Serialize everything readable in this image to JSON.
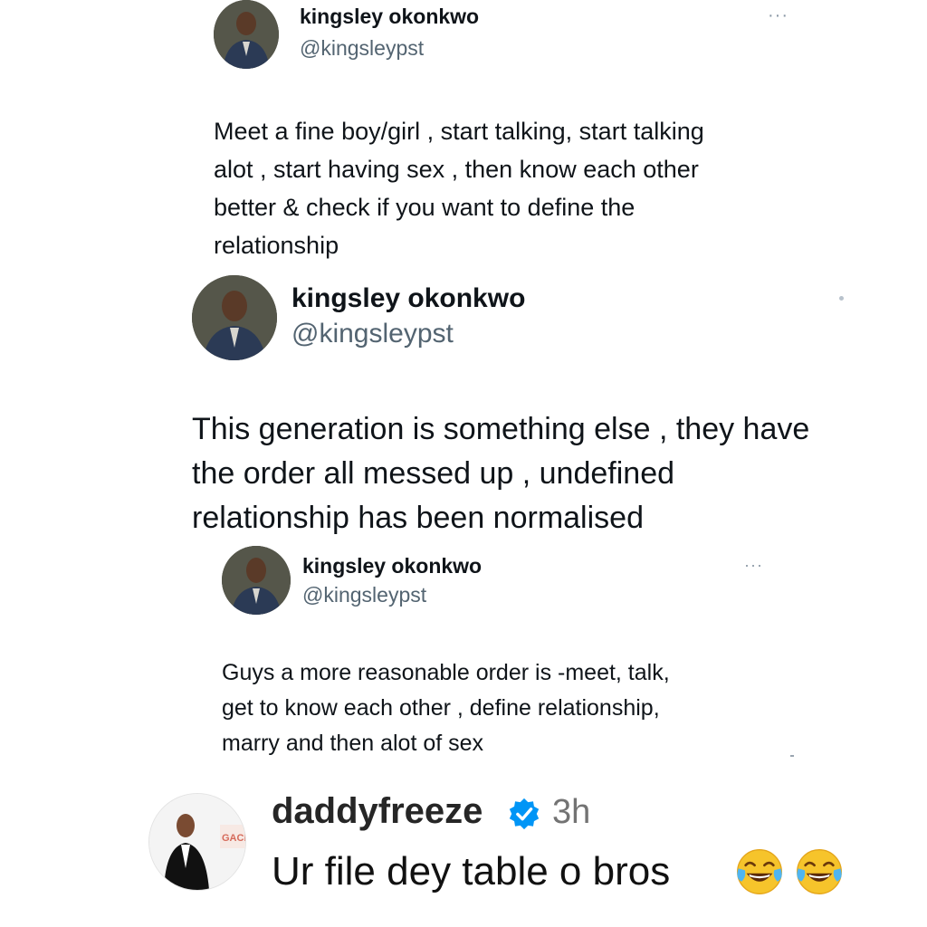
{
  "tweets": [
    {
      "name": "kingsley okonkwo",
      "handle": "@kingsleypst",
      "more": "···",
      "lines": [
        "Meet a fine boy/girl , start talking,  start talking",
        "alot , start having sex , then know each other",
        "better & check if you want to define the",
        "relationship"
      ]
    },
    {
      "name": "kingsley okonkwo",
      "handle": "@kingsleypst",
      "lines": [
        "This generation is something else , they have",
        "the order all messed up , undefined",
        "relationship has been normalised"
      ]
    },
    {
      "name": "kingsley okonkwo",
      "handle": "@kingsleypst",
      "more": "···",
      "lines": [
        "Guys a more reasonable order is -meet, talk,",
        "get to know each other , define relationship,",
        "marry and then alot of sex"
      ]
    }
  ],
  "comment": {
    "username": "daddyfreeze",
    "time": "3h",
    "text": "Ur file dey table o bros",
    "emojis": [
      "face-with-tears-of-joy-icon",
      "face-with-tears-of-joy-icon"
    ],
    "verified_color": "#0095f6",
    "avatar_text": "GACK"
  }
}
